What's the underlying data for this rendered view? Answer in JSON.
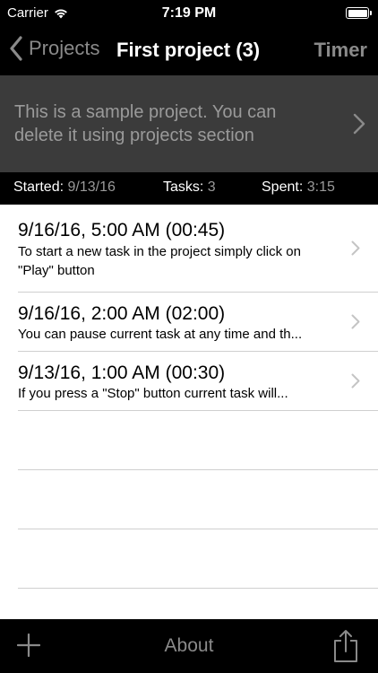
{
  "status_bar": {
    "carrier": "Carrier",
    "time": "7:19 PM"
  },
  "nav": {
    "back_label": "Projects",
    "title": "First project (3)",
    "right_button": "Timer"
  },
  "description": {
    "text": "This is a sample project. You can delete it using projects section"
  },
  "stats": {
    "started_label": "Started:",
    "started_value": "9/13/16",
    "tasks_label": "Tasks:",
    "tasks_value": "3",
    "spent_label": "Spent:",
    "spent_value": "3:15"
  },
  "tasks": [
    {
      "title": "9/16/16, 5:00 AM (00:45)",
      "subtitle": "To start a new task in the project simply click on \"Play\" button"
    },
    {
      "title": "9/16/16, 2:00 AM (02:00)",
      "subtitle": "You can pause current task at any time and th..."
    },
    {
      "title": "9/13/16, 1:00 AM (00:30)",
      "subtitle": "If you press a \"Stop\" button current task will..."
    }
  ],
  "toolbar": {
    "add_icon": "plus-icon",
    "about_label": "About",
    "share_icon": "share-icon"
  },
  "colors": {
    "background": "#000000",
    "description_bg": "#3b3b3b",
    "muted_text": "#8a8a8a",
    "list_bg": "#ffffff"
  }
}
